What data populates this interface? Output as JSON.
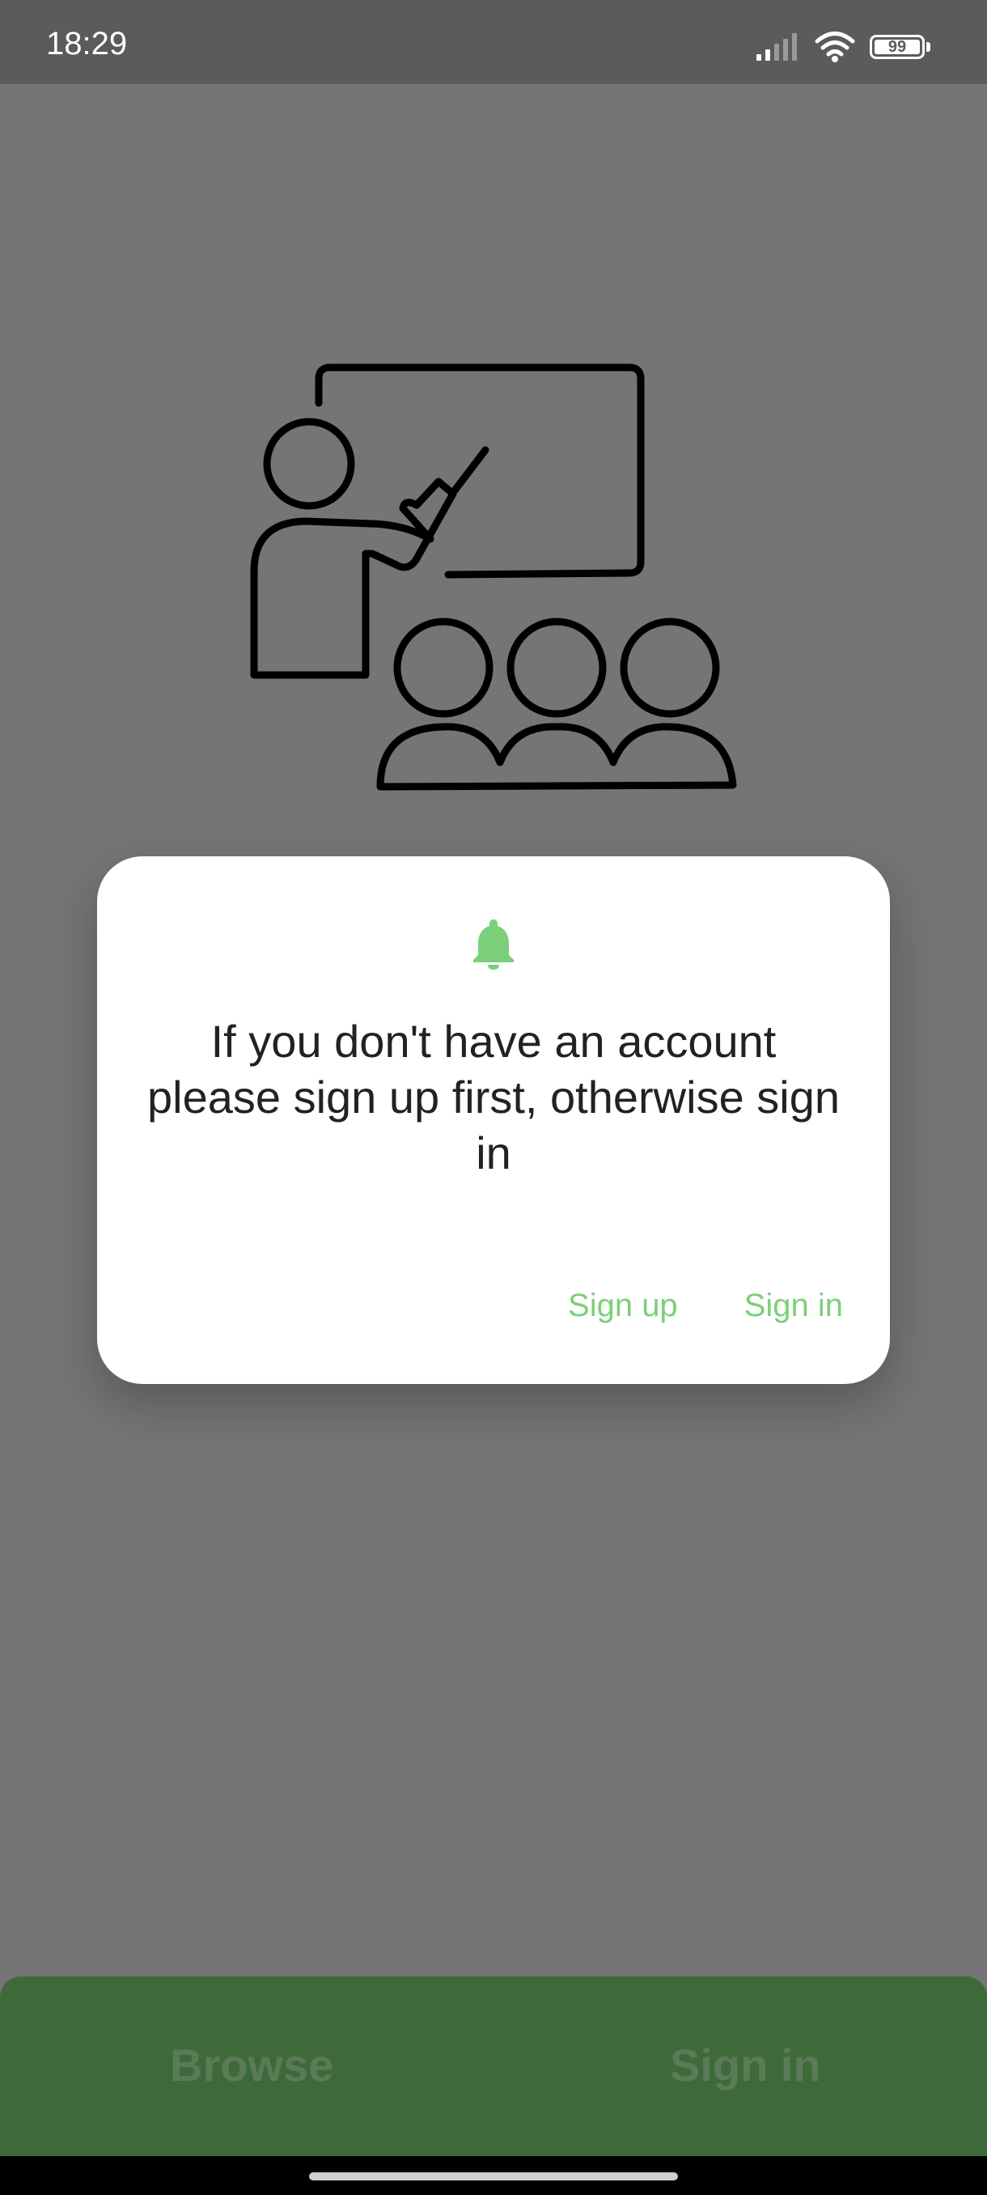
{
  "status_bar": {
    "time": "18:29",
    "battery_level": "99",
    "icons": [
      "signal-icon",
      "wifi-icon",
      "battery-icon"
    ]
  },
  "illustration": {
    "icon": "teacher-with-students-icon"
  },
  "dialog": {
    "icon": "bell-icon",
    "message": "If you don't have an account please sign up first, otherwise sign in",
    "sign_up_label": "Sign up",
    "sign_in_label": "Sign in"
  },
  "bottom": {
    "browse_label": "Browse",
    "sign_in_label": "Sign in"
  },
  "colors": {
    "accent": "#7ccf79",
    "scrim": "#757575",
    "bottom_panel": "#3e6a3a"
  }
}
